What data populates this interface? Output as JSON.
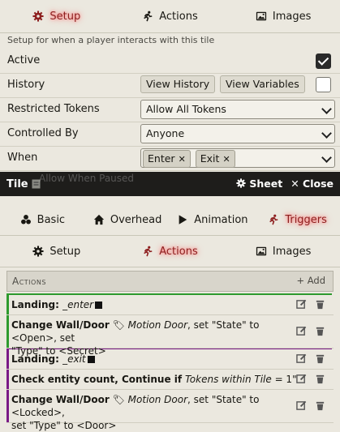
{
  "config_tabs": [
    {
      "label": "Setup",
      "icon": "gear-icon",
      "active": true
    },
    {
      "label": "Actions",
      "icon": "running-icon",
      "active": false
    },
    {
      "label": "Images",
      "icon": "image-icon",
      "active": false
    }
  ],
  "setup": {
    "hint": "Setup for when a player interacts with this tile",
    "active_label": "Active",
    "active_checked": true,
    "history_label": "History",
    "view_history": "View History",
    "view_variables": "View Variables",
    "history_checked": false,
    "restricted_label": "Restricted Tokens",
    "restricted_value": "Allow All Tokens",
    "controlled_label": "Controlled By",
    "controlled_value": "Anyone",
    "when_label": "When",
    "when_chips": [
      "Enter",
      "Exit"
    ],
    "allow_paused": "Allow When Paused"
  },
  "window": {
    "title": "Tile",
    "sheet_label": "Sheet",
    "close_label": "Close"
  },
  "sheet_tabs": [
    {
      "label": "Basic",
      "icon": "cubes-icon",
      "active": false
    },
    {
      "label": "Overhead",
      "icon": "home-icon",
      "active": false
    },
    {
      "label": "Animation",
      "icon": "play-icon",
      "active": false
    },
    {
      "label": "Triggers",
      "icon": "running-icon",
      "active": true
    }
  ],
  "sub_tabs": [
    {
      "label": "Setup",
      "icon": "gear-icon",
      "active": false
    },
    {
      "label": "Actions",
      "icon": "running-icon",
      "active": true
    },
    {
      "label": "Images",
      "icon": "image-icon",
      "active": false
    }
  ],
  "actions_header": {
    "title": "Actions",
    "add_label": "+ Add"
  },
  "actions": [
    {
      "landing": "Landing: ",
      "name": "_enter"
    },
    {
      "title": "Change Wall/Door",
      "ital": "Motion Door",
      "rest1": ", set \"State\" to <Open>, set",
      "rest2": "\"Type\" to <Secret>"
    },
    {
      "landing": "Landing: ",
      "name": "_exit"
    },
    {
      "title": "Check entity count, Continue if",
      "ital": "Tokens within Tile",
      "rest1": " = 1\""
    },
    {
      "title": "Change Wall/Door",
      "ital": "Motion Door",
      "rest1": ", set \"State\" to <Locked>,",
      "rest2": "set \"Type\" to <Door>"
    }
  ],
  "colors": {
    "active_tab": "#8d1f1f",
    "landing_enter": "#2e9a2e",
    "landing_exit": "#7a1a86",
    "titlebar": "#1e1d1b"
  }
}
